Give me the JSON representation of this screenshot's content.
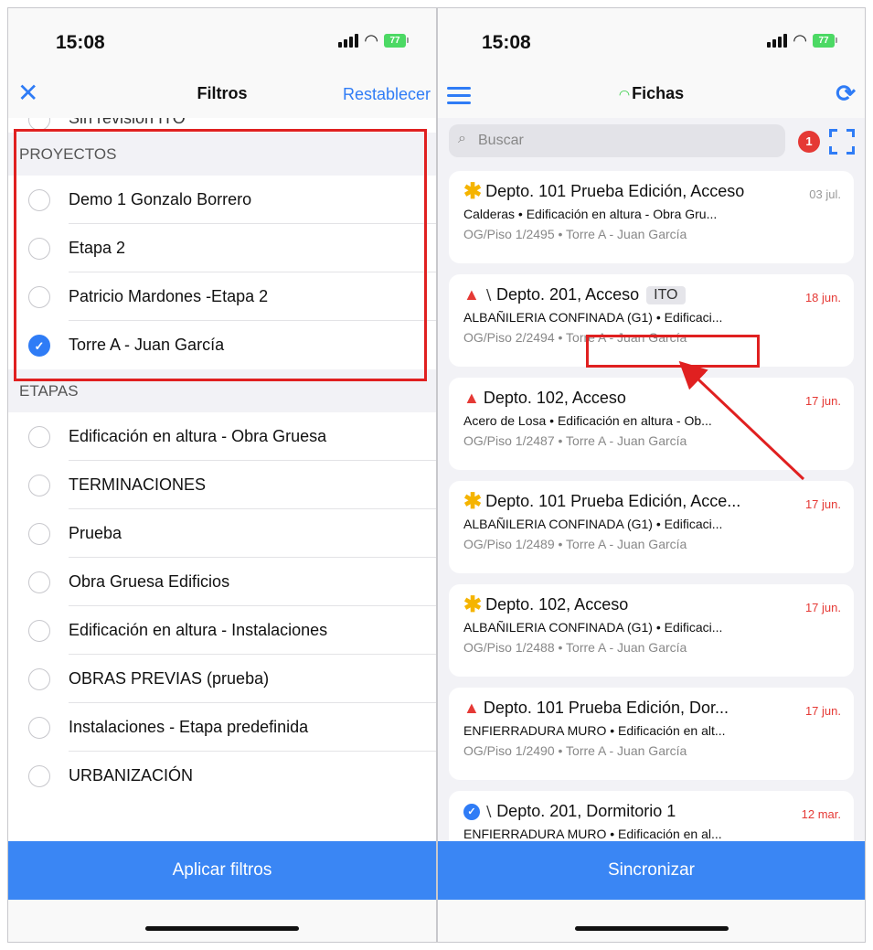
{
  "left": {
    "status": {
      "time": "15:08",
      "battery": "77"
    },
    "nav": {
      "title": "Filtros",
      "reset": "Restablecer"
    },
    "partial_row": "Sin revisión ITO",
    "sections": [
      {
        "header": "PROYECTOS",
        "items": [
          {
            "label": "Demo 1 Gonzalo Borrero",
            "checked": false
          },
          {
            "label": "Etapa 2",
            "checked": false
          },
          {
            "label": "Patricio Mardones -Etapa 2",
            "checked": false
          },
          {
            "label": "Torre A - Juan García",
            "checked": true
          }
        ]
      },
      {
        "header": "ETAPAS",
        "items": [
          {
            "label": "Edificación en altura - Obra Gruesa",
            "checked": false
          },
          {
            "label": "TERMINACIONES",
            "checked": false
          },
          {
            "label": "Prueba",
            "checked": false
          },
          {
            "label": "Obra Gruesa Edificios",
            "checked": false
          },
          {
            "label": "Edificación en altura - Instalaciones",
            "checked": false
          },
          {
            "label": "OBRAS PREVIAS (prueba)",
            "checked": false
          },
          {
            "label": "Instalaciones - Etapa predefinida",
            "checked": false
          },
          {
            "label": "URBANIZACIÓN",
            "checked": false
          }
        ]
      }
    ],
    "apply_button": "Aplicar filtros"
  },
  "right": {
    "status": {
      "time": "15:08",
      "battery": "77"
    },
    "nav": {
      "title": "Fichas"
    },
    "search": {
      "placeholder": "Buscar"
    },
    "badge": "1",
    "cards": [
      {
        "icon": "star",
        "clip": false,
        "check": false,
        "tag": "",
        "title": "Depto. 101 Prueba Edición, Acceso",
        "date": "03 jul.",
        "date_grey": true,
        "subtitle": "Calderas • Edificación en altura - Obra Gru...",
        "meta": "OG/Piso 1/2495 • Torre A - Juan García"
      },
      {
        "icon": "warning",
        "clip": true,
        "check": false,
        "tag": "ITO",
        "title": "Depto. 201, Acceso",
        "date": "18 jun.",
        "date_grey": false,
        "subtitle": "ALBAÑILERIA CONFINADA (G1) • Edificaci...",
        "meta": "OG/Piso 2/2494 • Torre A - Juan García"
      },
      {
        "icon": "warning",
        "clip": false,
        "check": false,
        "tag": "",
        "title": "Depto. 102, Acceso",
        "date": "17 jun.",
        "date_grey": false,
        "subtitle": "Acero de Losa • Edificación en altura - Ob...",
        "meta": "OG/Piso 1/2487 • Torre A - Juan García"
      },
      {
        "icon": "star",
        "clip": false,
        "check": false,
        "tag": "",
        "title": "Depto. 101 Prueba Edición, Acce...",
        "date": "17 jun.",
        "date_grey": false,
        "subtitle": "ALBAÑILERIA CONFINADA (G1) • Edificaci...",
        "meta": "OG/Piso 1/2489 • Torre A - Juan García"
      },
      {
        "icon": "star",
        "clip": false,
        "check": false,
        "tag": "",
        "title": "Depto. 102, Acceso",
        "date": "17 jun.",
        "date_grey": false,
        "subtitle": "ALBAÑILERIA CONFINADA (G1) • Edificaci...",
        "meta": "OG/Piso 1/2488 • Torre A - Juan García"
      },
      {
        "icon": "warning",
        "clip": false,
        "check": false,
        "tag": "",
        "title": "Depto. 101 Prueba Edición, Dor...",
        "date": "17 jun.",
        "date_grey": false,
        "subtitle": "ENFIERRADURA MURO • Edificación en alt...",
        "meta": "OG/Piso 1/2490 • Torre A - Juan García"
      },
      {
        "icon": "none",
        "clip": true,
        "check": true,
        "tag": "",
        "title": "Depto. 201, Dormitorio 1",
        "date": "12 mar.",
        "date_grey": false,
        "subtitle": "ENFIERRADURA MURO • Edificación en al...",
        "meta": ""
      }
    ],
    "sync_button": "Sincronizar"
  },
  "colors": {
    "accent": "#2f7cf6",
    "button": "#3a86f4",
    "annotation": "#e02020",
    "alert": "#e53935",
    "star": "#f5b400"
  }
}
